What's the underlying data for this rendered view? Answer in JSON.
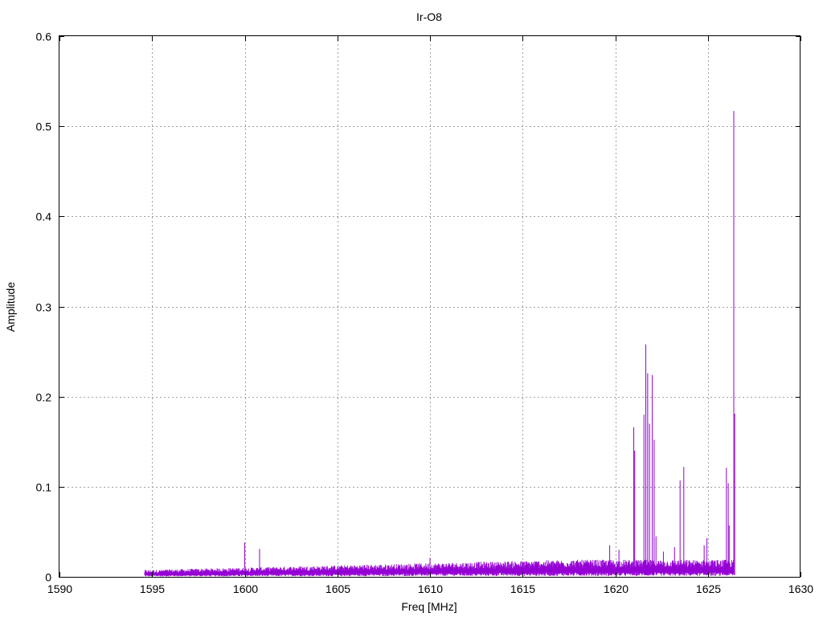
{
  "chart_data": {
    "type": "line",
    "title": "Ir-O8",
    "xlabel": "Freq [MHz]",
    "ylabel": "Amplitude",
    "xlim": [
      1590,
      1630
    ],
    "ylim": [
      0,
      0.6
    ],
    "x_ticks": [
      "1590",
      "1595",
      "1600",
      "1605",
      "1610",
      "1615",
      "1620",
      "1625",
      "1630"
    ],
    "y_ticks": [
      "0",
      "0.1",
      "0.2",
      "0.3",
      "0.4",
      "0.5",
      "0.6"
    ],
    "grid": true,
    "series": [
      {
        "color": "#9400d3",
        "x_range": [
          1594.6,
          1626.4
        ],
        "noise_floor_start": 0.004,
        "noise_floor_end": 0.01,
        "peaks": [
          {
            "x": 1600.0,
            "y": 0.038
          },
          {
            "x": 1600.8,
            "y": 0.031
          },
          {
            "x": 1610.0,
            "y": 0.021
          },
          {
            "x": 1619.7,
            "y": 0.035
          },
          {
            "x": 1620.2,
            "y": 0.03
          },
          {
            "x": 1621.0,
            "y": 0.166
          },
          {
            "x": 1621.05,
            "y": 0.14
          },
          {
            "x": 1621.55,
            "y": 0.18
          },
          {
            "x": 1621.65,
            "y": 0.258
          },
          {
            "x": 1621.75,
            "y": 0.226
          },
          {
            "x": 1621.85,
            "y": 0.17
          },
          {
            "x": 1622.0,
            "y": 0.224
          },
          {
            "x": 1622.1,
            "y": 0.152
          },
          {
            "x": 1622.2,
            "y": 0.045
          },
          {
            "x": 1622.6,
            "y": 0.028
          },
          {
            "x": 1623.2,
            "y": 0.033
          },
          {
            "x": 1623.5,
            "y": 0.107
          },
          {
            "x": 1623.7,
            "y": 0.122
          },
          {
            "x": 1624.8,
            "y": 0.035
          },
          {
            "x": 1624.95,
            "y": 0.043
          },
          {
            "x": 1626.0,
            "y": 0.121
          },
          {
            "x": 1626.1,
            "y": 0.104
          },
          {
            "x": 1626.15,
            "y": 0.057
          },
          {
            "x": 1626.4,
            "y": 0.517
          },
          {
            "x": 1626.45,
            "y": 0.181
          }
        ]
      }
    ]
  }
}
